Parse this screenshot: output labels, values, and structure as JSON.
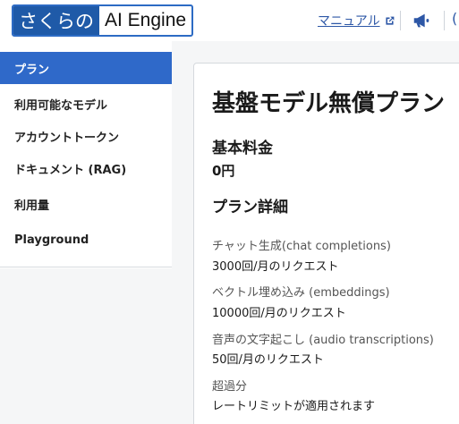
{
  "header": {
    "logo_part1": "さくらの",
    "logo_part2": "AI Engine",
    "manual_label": "マニュアル",
    "cut_glyph": "("
  },
  "sidebar": {
    "items": [
      {
        "label": "プラン",
        "active": true
      },
      {
        "label": "利用可能なモデル",
        "active": false
      },
      {
        "label": "アカウントトークン",
        "active": false
      },
      {
        "label": "ドキュメント (RAG)",
        "active": false
      },
      {
        "label": "利用量",
        "active": false
      },
      {
        "label": "Playground",
        "active": false
      }
    ]
  },
  "main": {
    "title": "基盤モデル無償プラン",
    "base_fee_heading": "基本料金",
    "base_fee_value": "0円",
    "plan_detail_heading": "プラン詳細",
    "details": [
      {
        "label": "チャット生成(chat completions)",
        "value": "3000回/月のリクエスト"
      },
      {
        "label": "ベクトル埋め込み (embeddings)",
        "value": "10000回/月のリクエスト"
      },
      {
        "label": "音声の文字起こし (audio transcriptions)",
        "value": "50回/月のリクエスト"
      },
      {
        "label": "超過分",
        "value": "レートリミットが適用されます"
      }
    ]
  },
  "colors": {
    "accent": "#2f69c9",
    "logo_bg": "#1f5aa8",
    "link": "#2d57a6"
  }
}
